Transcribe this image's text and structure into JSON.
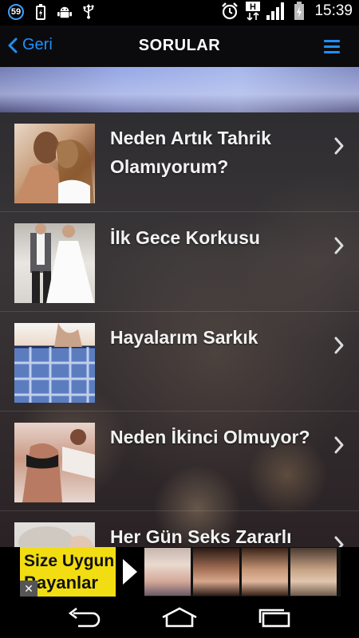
{
  "status_bar": {
    "notification_count": "59",
    "time": "15:39",
    "icons": [
      "battery-charging-icon",
      "android-debug-icon",
      "usb-icon",
      "alarm-icon",
      "h-network-icon",
      "signal-icon",
      "battery-icon"
    ]
  },
  "navbar": {
    "back_label": "Geri",
    "title": "SORULAR",
    "accent_color": "#1e90ff"
  },
  "questions": [
    {
      "title": "Neden Artık Tahrik Olamıyorum?"
    },
    {
      "title": "İlk Gece Korkusu"
    },
    {
      "title": "Hayalarım Sarkık"
    },
    {
      "title": "Neden İkinci Olmuyor?"
    },
    {
      "title": "Her Gün Seks Zararlı"
    }
  ],
  "ad": {
    "line1": "Size Uygun",
    "line2": "Bayanlar",
    "close_label": "✕",
    "background_color": "#f2dd13"
  }
}
